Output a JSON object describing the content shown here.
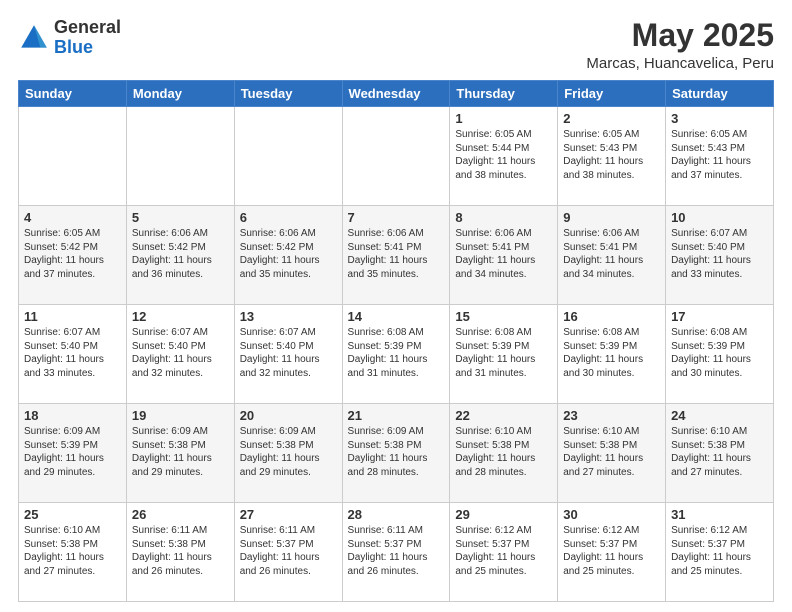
{
  "logo": {
    "general": "General",
    "blue": "Blue"
  },
  "header": {
    "month": "May 2025",
    "location": "Marcas, Huancavelica, Peru"
  },
  "weekdays": [
    "Sunday",
    "Monday",
    "Tuesday",
    "Wednesday",
    "Thursday",
    "Friday",
    "Saturday"
  ],
  "weeks": [
    [
      {
        "day": "",
        "info": ""
      },
      {
        "day": "",
        "info": ""
      },
      {
        "day": "",
        "info": ""
      },
      {
        "day": "",
        "info": ""
      },
      {
        "day": "1",
        "info": "Sunrise: 6:05 AM\nSunset: 5:44 PM\nDaylight: 11 hours\nand 38 minutes."
      },
      {
        "day": "2",
        "info": "Sunrise: 6:05 AM\nSunset: 5:43 PM\nDaylight: 11 hours\nand 38 minutes."
      },
      {
        "day": "3",
        "info": "Sunrise: 6:05 AM\nSunset: 5:43 PM\nDaylight: 11 hours\nand 37 minutes."
      }
    ],
    [
      {
        "day": "4",
        "info": "Sunrise: 6:05 AM\nSunset: 5:42 PM\nDaylight: 11 hours\nand 37 minutes."
      },
      {
        "day": "5",
        "info": "Sunrise: 6:06 AM\nSunset: 5:42 PM\nDaylight: 11 hours\nand 36 minutes."
      },
      {
        "day": "6",
        "info": "Sunrise: 6:06 AM\nSunset: 5:42 PM\nDaylight: 11 hours\nand 35 minutes."
      },
      {
        "day": "7",
        "info": "Sunrise: 6:06 AM\nSunset: 5:41 PM\nDaylight: 11 hours\nand 35 minutes."
      },
      {
        "day": "8",
        "info": "Sunrise: 6:06 AM\nSunset: 5:41 PM\nDaylight: 11 hours\nand 34 minutes."
      },
      {
        "day": "9",
        "info": "Sunrise: 6:06 AM\nSunset: 5:41 PM\nDaylight: 11 hours\nand 34 minutes."
      },
      {
        "day": "10",
        "info": "Sunrise: 6:07 AM\nSunset: 5:40 PM\nDaylight: 11 hours\nand 33 minutes."
      }
    ],
    [
      {
        "day": "11",
        "info": "Sunrise: 6:07 AM\nSunset: 5:40 PM\nDaylight: 11 hours\nand 33 minutes."
      },
      {
        "day": "12",
        "info": "Sunrise: 6:07 AM\nSunset: 5:40 PM\nDaylight: 11 hours\nand 32 minutes."
      },
      {
        "day": "13",
        "info": "Sunrise: 6:07 AM\nSunset: 5:40 PM\nDaylight: 11 hours\nand 32 minutes."
      },
      {
        "day": "14",
        "info": "Sunrise: 6:08 AM\nSunset: 5:39 PM\nDaylight: 11 hours\nand 31 minutes."
      },
      {
        "day": "15",
        "info": "Sunrise: 6:08 AM\nSunset: 5:39 PM\nDaylight: 11 hours\nand 31 minutes."
      },
      {
        "day": "16",
        "info": "Sunrise: 6:08 AM\nSunset: 5:39 PM\nDaylight: 11 hours\nand 30 minutes."
      },
      {
        "day": "17",
        "info": "Sunrise: 6:08 AM\nSunset: 5:39 PM\nDaylight: 11 hours\nand 30 minutes."
      }
    ],
    [
      {
        "day": "18",
        "info": "Sunrise: 6:09 AM\nSunset: 5:39 PM\nDaylight: 11 hours\nand 29 minutes."
      },
      {
        "day": "19",
        "info": "Sunrise: 6:09 AM\nSunset: 5:38 PM\nDaylight: 11 hours\nand 29 minutes."
      },
      {
        "day": "20",
        "info": "Sunrise: 6:09 AM\nSunset: 5:38 PM\nDaylight: 11 hours\nand 29 minutes."
      },
      {
        "day": "21",
        "info": "Sunrise: 6:09 AM\nSunset: 5:38 PM\nDaylight: 11 hours\nand 28 minutes."
      },
      {
        "day": "22",
        "info": "Sunrise: 6:10 AM\nSunset: 5:38 PM\nDaylight: 11 hours\nand 28 minutes."
      },
      {
        "day": "23",
        "info": "Sunrise: 6:10 AM\nSunset: 5:38 PM\nDaylight: 11 hours\nand 27 minutes."
      },
      {
        "day": "24",
        "info": "Sunrise: 6:10 AM\nSunset: 5:38 PM\nDaylight: 11 hours\nand 27 minutes."
      }
    ],
    [
      {
        "day": "25",
        "info": "Sunrise: 6:10 AM\nSunset: 5:38 PM\nDaylight: 11 hours\nand 27 minutes."
      },
      {
        "day": "26",
        "info": "Sunrise: 6:11 AM\nSunset: 5:38 PM\nDaylight: 11 hours\nand 26 minutes."
      },
      {
        "day": "27",
        "info": "Sunrise: 6:11 AM\nSunset: 5:37 PM\nDaylight: 11 hours\nand 26 minutes."
      },
      {
        "day": "28",
        "info": "Sunrise: 6:11 AM\nSunset: 5:37 PM\nDaylight: 11 hours\nand 26 minutes."
      },
      {
        "day": "29",
        "info": "Sunrise: 6:12 AM\nSunset: 5:37 PM\nDaylight: 11 hours\nand 25 minutes."
      },
      {
        "day": "30",
        "info": "Sunrise: 6:12 AM\nSunset: 5:37 PM\nDaylight: 11 hours\nand 25 minutes."
      },
      {
        "day": "31",
        "info": "Sunrise: 6:12 AM\nSunset: 5:37 PM\nDaylight: 11 hours\nand 25 minutes."
      }
    ]
  ]
}
